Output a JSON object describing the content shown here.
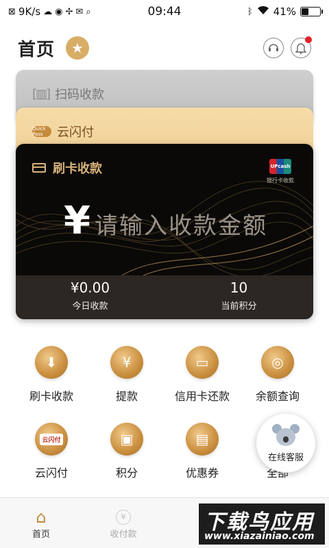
{
  "status_bar": {
    "network_speed": "9K/s",
    "time": "09:44",
    "battery": "41%",
    "battery_level": 0.41
  },
  "header": {
    "title": "首页"
  },
  "cards": {
    "scan": {
      "label": "扫码收款"
    },
    "cloud": {
      "label": "云闪付",
      "logo_text": "Quick Pass"
    },
    "swipe": {
      "label": "刷卡收款",
      "upcash_logo": "UPcash",
      "upcash_caption": "银行卡收款",
      "currency_symbol": "¥",
      "amount_placeholder": "请输入收款金额",
      "stats": [
        {
          "value": "¥0.00",
          "label": "今日收款"
        },
        {
          "value": "10",
          "label": "当前积分"
        }
      ]
    }
  },
  "features": [
    {
      "label": "刷卡收款",
      "icon": "card-down-icon"
    },
    {
      "label": "提款",
      "icon": "money-bag-icon"
    },
    {
      "label": "信用卡还款",
      "icon": "credit-card-icon"
    },
    {
      "label": "余额查询",
      "icon": "coins-icon"
    },
    {
      "label": "云闪付",
      "icon": "cloud-pay-icon",
      "icon_text": "云闪付"
    },
    {
      "label": "积分",
      "icon": "gift-icon"
    },
    {
      "label": "优惠券",
      "icon": "coupon-icon"
    },
    {
      "label": "全部",
      "icon": "grid-icon"
    }
  ],
  "floating_service": {
    "label": "在线客服"
  },
  "bottom_nav": [
    {
      "label": "首页",
      "active": true
    },
    {
      "label": "收付款",
      "active": false
    }
  ],
  "watermark": {
    "title": "下载鸟应用",
    "url": "www.xiazainiao.com"
  },
  "colors": {
    "gold": "#d8ad66",
    "gold_text": "#d9b27a",
    "card_dark": "#0a0908",
    "notification": "#e6212a"
  }
}
